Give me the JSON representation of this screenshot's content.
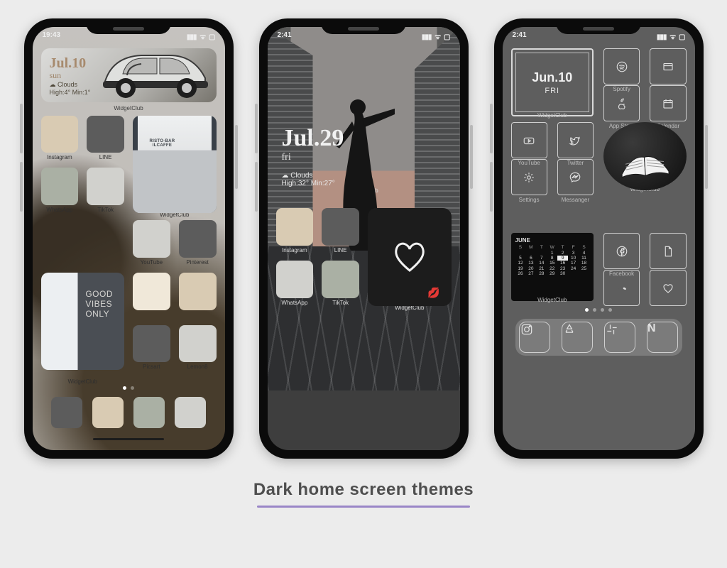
{
  "caption": "Dark home screen themes",
  "phone1": {
    "time": "19:43",
    "widget": {
      "date": "Jul.10",
      "day": "sun",
      "sky": "☁ Clouds",
      "temp": "High:4° Min:1°",
      "label": "WidgetClub",
      "sign_l1": "RISTO·BAR",
      "sign_l2": "ILCAFFE"
    },
    "apps_row1": {
      "a": "Instagram",
      "b": "LINE"
    },
    "apps_row2": {
      "a": "WhatsApp",
      "b": "TikTok",
      "c": "WidgetClub"
    },
    "apps_row3": {
      "b": "YouTube",
      "c": "Pinterest"
    },
    "good": "GOOD\nVIBES\nONLY",
    "widget2_label": "WidgetClub",
    "apps_row4": {
      "b": "Picsart",
      "c": "Lemon8"
    }
  },
  "phone2": {
    "time": "2:41",
    "widget": {
      "date": "Jul.29",
      "day": "fri",
      "sky": "☁ Clouds",
      "temp": "High:32° Min:27°",
      "label": "WidgetClub"
    },
    "apps": {
      "a": "Instagram",
      "b": "LINE",
      "c": "WhatsApp",
      "d": "TikTok",
      "w": "WidgetClub"
    },
    "kiss": "💋"
  },
  "phone3": {
    "time": "2:41",
    "dateW": {
      "date": "Jun.10",
      "day": "FRI",
      "label": "WidgetClub"
    },
    "apps": {
      "spotify": "Spotify",
      "appstore": "App Store",
      "calendar": "Calendar",
      "youtube": "YouTube",
      "twitter": "Twitter",
      "settings": "Settings",
      "messenger": "Messanger",
      "facebook": "Facebook",
      "widget": "WidgetClub"
    },
    "cal": {
      "month": "JUNE",
      "dow": [
        "S",
        "M",
        "T",
        "W",
        "T",
        "F",
        "S"
      ],
      "rows": [
        [
          "",
          "",
          "",
          "1",
          "2",
          "3",
          "4"
        ],
        [
          "5",
          "6",
          "7",
          "8",
          "9",
          "10",
          "11"
        ],
        [
          "12",
          "13",
          "14",
          "15",
          "16",
          "17",
          "18"
        ],
        [
          "19",
          "20",
          "21",
          "22",
          "23",
          "24",
          "25"
        ],
        [
          "26",
          "27",
          "28",
          "29",
          "30",
          "",
          ""
        ]
      ],
      "hl": "9",
      "label": "WidgetClub"
    },
    "dock_n": "N"
  }
}
